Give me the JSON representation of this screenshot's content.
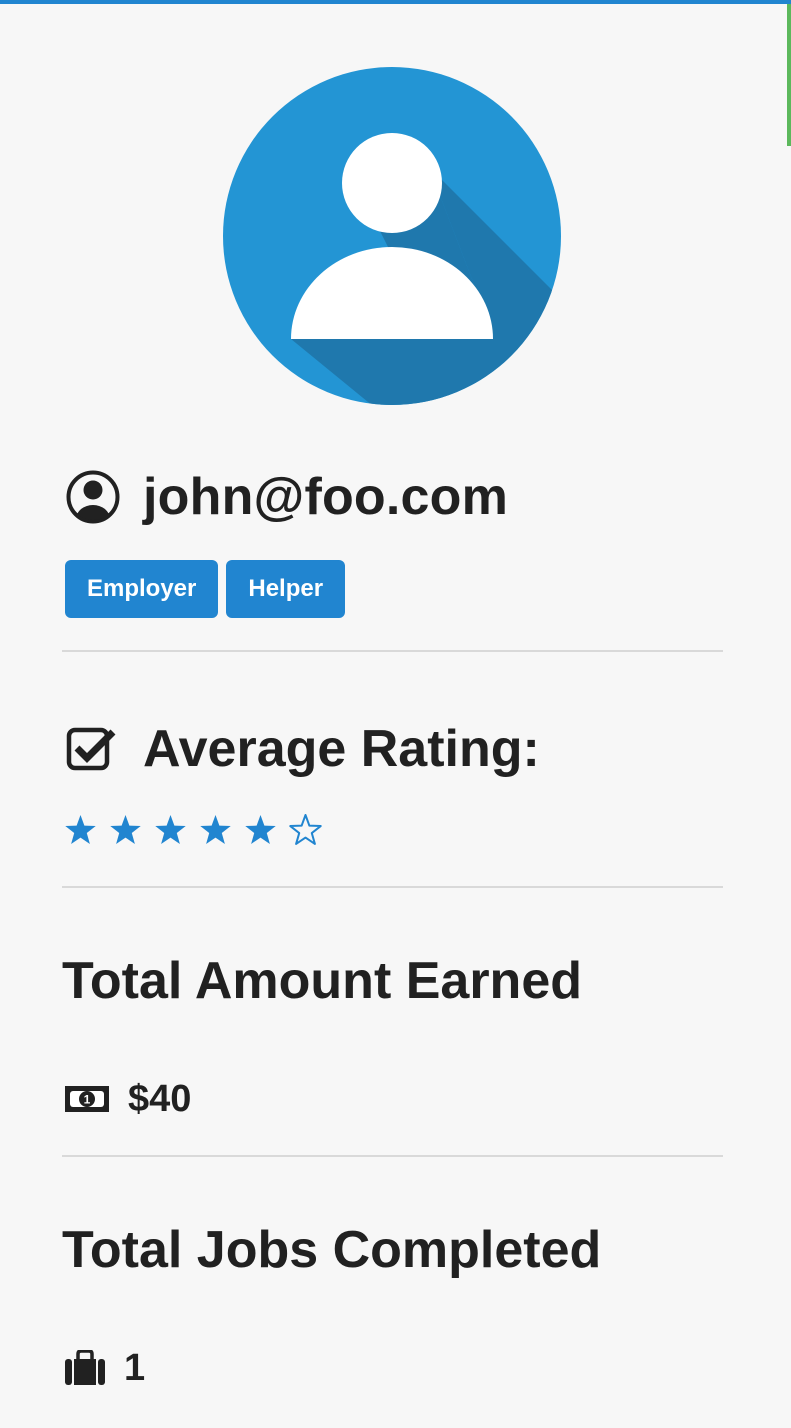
{
  "colors": {
    "accent": "#2185d0",
    "avatar_bg": "#2395d4",
    "avatar_shadow": "#1f78ad",
    "top_bar": "#2185d0",
    "side_accent": "#5cb85c",
    "text": "#212121",
    "divider": "#d9d9d9"
  },
  "profile": {
    "avatar_icon": "user-avatar-icon",
    "email": "john@foo.com",
    "user_icon": "user-circle-icon",
    "roles": [
      "Employer",
      "Helper"
    ]
  },
  "rating": {
    "title": "Average Rating:",
    "icon": "check-square-icon",
    "stars_filled": 5,
    "stars_total": 6
  },
  "earnings": {
    "title": "Total Amount Earned",
    "icon": "money-bill-icon",
    "value": "$40"
  },
  "jobs": {
    "title": "Total Jobs Completed",
    "icon": "briefcase-icon",
    "value": "1"
  }
}
